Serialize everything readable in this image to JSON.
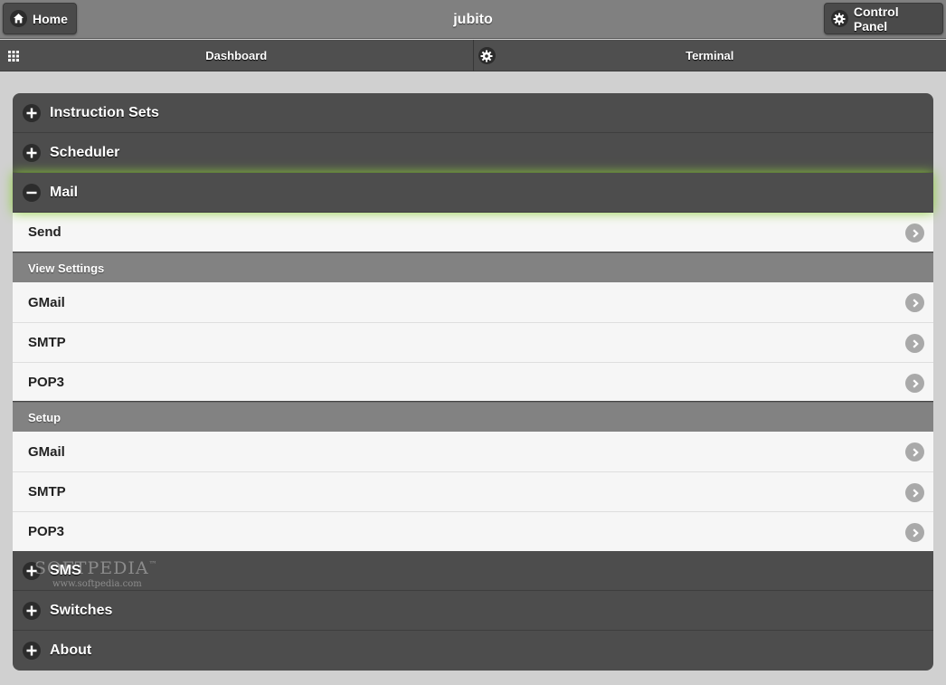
{
  "header": {
    "title": "jubito",
    "home_label": "Home",
    "control_panel_label": "Control Panel"
  },
  "navbar": {
    "tabs": [
      {
        "label": "Dashboard",
        "icon": "grid-icon"
      },
      {
        "label": "Terminal",
        "icon": "gear-icon"
      }
    ]
  },
  "accordion": {
    "sections": [
      {
        "label": "Instruction Sets",
        "state": "collapsed"
      },
      {
        "label": "Scheduler",
        "state": "collapsed"
      },
      {
        "label": "Mail",
        "state": "expanded"
      },
      {
        "label": "SMS",
        "state": "collapsed"
      },
      {
        "label": "Switches",
        "state": "collapsed"
      },
      {
        "label": "About",
        "state": "collapsed"
      }
    ],
    "mail": {
      "send_label": "Send",
      "view_settings": {
        "title": "View Settings",
        "items": [
          "GMail",
          "SMTP",
          "POP3"
        ]
      },
      "setup": {
        "title": "Setup",
        "items": [
          "GMail",
          "SMTP",
          "POP3"
        ]
      }
    }
  },
  "watermark": {
    "brand": "SOFTPEDIA",
    "tm": "™",
    "url": "www.softpedia.com"
  },
  "colors": {
    "header_bg": "#808080",
    "navbar_bg": "#4f4f4f",
    "section_bg": "#4d4d4d",
    "list_bg": "#f6f6f6",
    "divider_bg": "#828282",
    "focus_glow": "#8fcf3c"
  }
}
